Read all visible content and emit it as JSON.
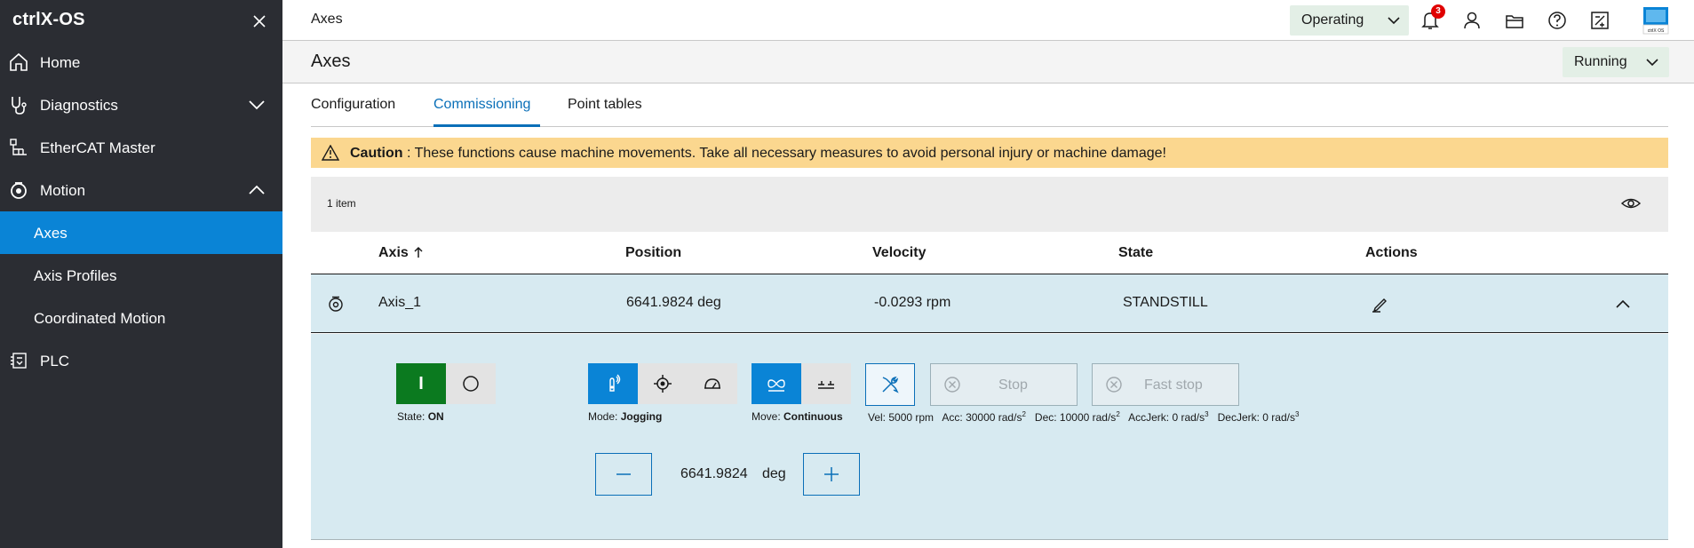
{
  "app": {
    "title": "ctrlX-OS"
  },
  "sidebar": {
    "items": [
      {
        "label": "Home",
        "icon": "home-icon"
      },
      {
        "label": "Diagnostics",
        "icon": "stethoscope-icon"
      },
      {
        "label": "EtherCAT Master",
        "icon": "network-icon"
      },
      {
        "label": "Motion",
        "icon": "motion-icon"
      },
      {
        "label": "Axes"
      },
      {
        "label": "Axis Profiles"
      },
      {
        "label": "Coordinated Motion"
      },
      {
        "label": "PLC",
        "icon": "plc-icon"
      }
    ],
    "active_color": "#0a84d6"
  },
  "topbar": {
    "title": "Axes",
    "mode": "Operating",
    "notifications": "3",
    "brand_label": "ctrlX OS"
  },
  "page": {
    "title": "Axes",
    "state": "Running"
  },
  "tabs": [
    {
      "label": "Configuration"
    },
    {
      "label": "Commissioning"
    },
    {
      "label": "Point tables"
    }
  ],
  "caution": {
    "title": "Caution",
    "message": " : These functions cause machine movements. Take all necessary measures to avoid personal injury or machine damage!"
  },
  "table": {
    "count": "1 item",
    "headers": {
      "axis": "Axis",
      "position": "Position",
      "velocity": "Velocity",
      "state": "State",
      "actions": "Actions"
    },
    "rows": [
      {
        "axis": "Axis_1",
        "position": "6641.9824 deg",
        "velocity": "-0.0293 rpm",
        "state": "STANDSTILL"
      }
    ]
  },
  "commissioning": {
    "power_on_label": "I",
    "state_caption": "State: ",
    "state_value": "ON",
    "mode_caption": "Mode: ",
    "mode_value": "Jogging",
    "move_caption": "Move: ",
    "move_value": "Continuous",
    "stop_label": "Stop",
    "fast_stop_label": "Fast stop",
    "vel": "Vel: 5000 rpm",
    "acc": "Acc: 30000 rad/s",
    "dec": "Dec: 10000 rad/s",
    "accjerk": "AccJerk: 0 rad/s",
    "decjerk": "DecJerk: 0 rad/s",
    "exp2": "2",
    "exp3": "3",
    "position_value": "6641.9824",
    "position_unit": "deg"
  }
}
